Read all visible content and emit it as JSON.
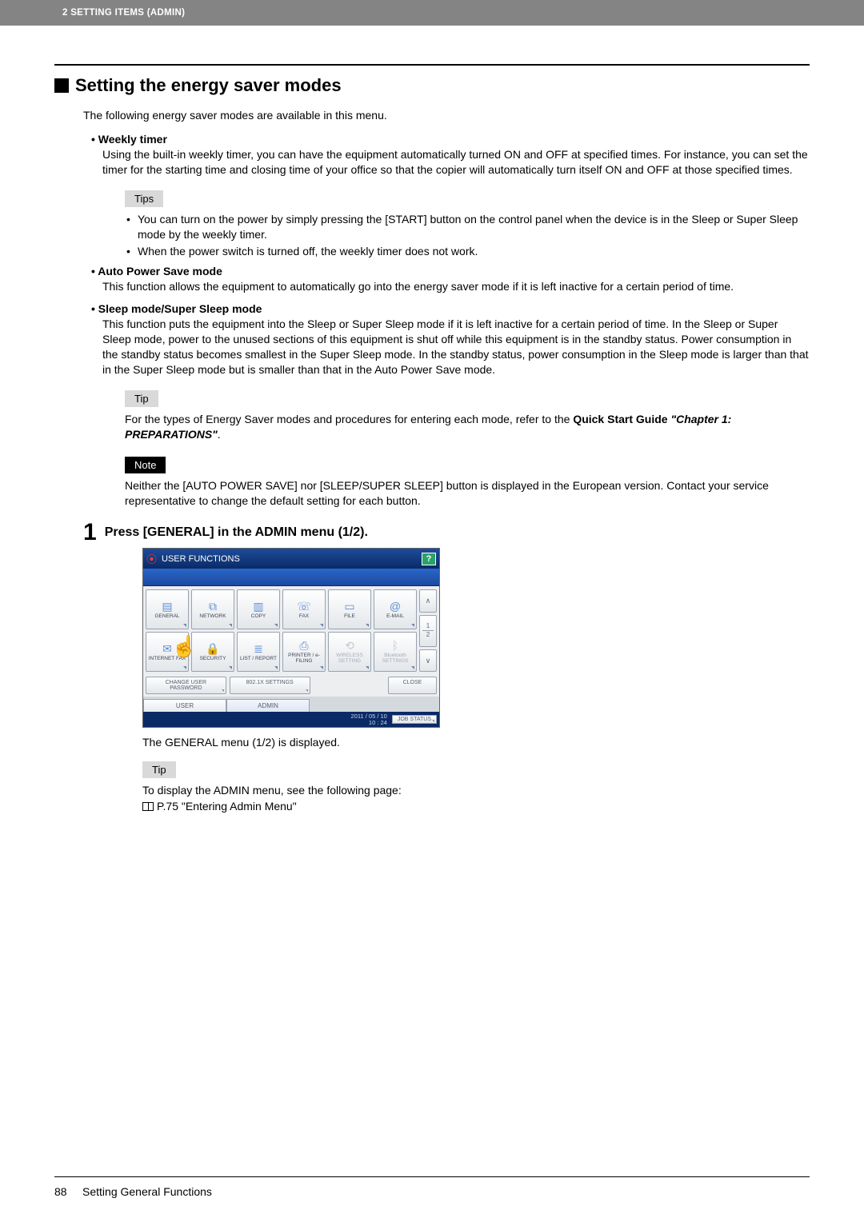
{
  "header": {
    "breadcrumb": "2 SETTING ITEMS (ADMIN)"
  },
  "section": {
    "title": "Setting the energy saver modes",
    "intro": "The following energy saver modes are available in this menu."
  },
  "bullets": {
    "weekly": {
      "title": "Weekly timer",
      "body": "Using the built-in weekly timer, you can have the equipment automatically turned ON and OFF at specified times. For instance, you can set the timer for the starting time and closing time of your office so that the copier will automatically turn itself ON and OFF at those specified times."
    },
    "tips_label": "Tips",
    "tips": {
      "a": "You can turn on the power by simply pressing the [START] button on the control panel when the device is in the Sleep or Super Sleep mode by the weekly timer.",
      "b": "When the power switch is turned off, the weekly timer does not work."
    },
    "auto": {
      "title": "Auto Power Save mode",
      "body": "This function allows the equipment to automatically go into the energy saver mode if it is left inactive for a certain period of time."
    },
    "sleep": {
      "title": "Sleep mode/Super Sleep mode",
      "body": "This function puts the equipment into the Sleep or Super Sleep mode if it is left inactive for a certain period of time. In the Sleep or Super Sleep mode, power to the unused sections of this equipment is shut off while this equipment is in the standby status. Power consumption in the standby status becomes smallest in the Super Sleep mode. In the standby status, power consumption in the Sleep mode is larger than that in the Super Sleep mode but is smaller than that in the Auto Power Save mode."
    }
  },
  "tip1": {
    "label": "Tip",
    "body_pre": "For the types of Energy Saver modes and procedures for entering each mode, refer to the ",
    "ref_bold": "Quick Start Guide",
    "ref_italic": "\"Chapter 1: PREPARATIONS\"",
    "body_post": "."
  },
  "note": {
    "label": "Note",
    "body": "Neither the [AUTO POWER SAVE] nor [SLEEP/SUPER SLEEP] button is displayed in the European version. Contact your service representative to change the default setting for each button."
  },
  "step": {
    "num": "1",
    "title": "Press [GENERAL] in the ADMIN menu (1/2).",
    "after": "The GENERAL menu (1/2) is displayed."
  },
  "device": {
    "title": "USER FUNCTIONS",
    "help": "?",
    "tiles_row1": [
      {
        "label": "GENERAL",
        "icon": "📄"
      },
      {
        "label": "NETWORK",
        "icon": "🖧"
      },
      {
        "label": "COPY",
        "icon": "📋"
      },
      {
        "label": "FAX",
        "icon": "📠"
      },
      {
        "label": "FILE",
        "icon": "📁"
      },
      {
        "label": "E-MAIL",
        "icon": "@"
      }
    ],
    "tiles_row2": [
      {
        "label": "INTERNET FAX",
        "icon": "📠"
      },
      {
        "label": "SECURITY",
        "icon": "🔒"
      },
      {
        "label": "LIST / REPORT",
        "icon": "📃"
      },
      {
        "label": "PRINTER / e-FILING",
        "icon": "🖨"
      },
      {
        "label": "WIRELESS SETTING",
        "icon": "⟲",
        "dim": true
      },
      {
        "label": "Bluetooth SETTINGS",
        "icon": "ᛒ",
        "dim": true
      }
    ],
    "pager": {
      "up": "∧",
      "p1": "1",
      "p2": "2",
      "down": "∨"
    },
    "lower": {
      "change_pw": "CHANGE USER PASSWORD",
      "dot1x": "802.1X SETTINGS",
      "close": "CLOSE"
    },
    "tabs": {
      "user": "USER",
      "admin": "ADMIN"
    },
    "status": {
      "ts1": "2011 / 05 / 10",
      "ts2": "10 : 24",
      "job": "JOB STATUS"
    }
  },
  "tip2": {
    "label": "Tip",
    "line1": "To display the ADMIN menu, see the following page:",
    "line2": "P.75 \"Entering Admin Menu\""
  },
  "footer": {
    "page": "88",
    "title": "Setting General Functions"
  }
}
